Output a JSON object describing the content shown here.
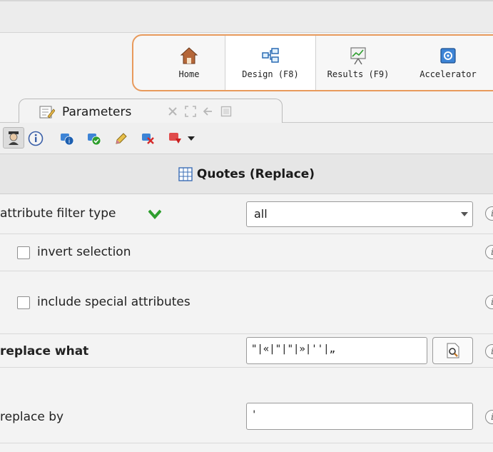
{
  "perspectives": {
    "home": {
      "label": "Home",
      "icon": "home-icon"
    },
    "design": {
      "label": "Design (F8)",
      "icon": "design-icon"
    },
    "results": {
      "label": "Results (F9)",
      "icon": "results-icon"
    },
    "accelerator": {
      "label": "Accelerator",
      "icon": "accelerator-icon"
    }
  },
  "panel_tab": {
    "label": "Parameters"
  },
  "operator": {
    "title": "Quotes (Replace)"
  },
  "params": {
    "attribute_filter_type": {
      "label": "attribute filter type",
      "value": "all"
    },
    "invert_selection": {
      "label": "invert selection",
      "checked": false
    },
    "include_special_attributes": {
      "label": "include special attributes",
      "checked": false
    },
    "replace_what": {
      "label": "replace what",
      "value": "\"|«|\"|\"|»|''|„"
    },
    "replace_by": {
      "label": "replace by",
      "value": "'"
    }
  },
  "colors": {
    "accent_orange": "#e89a5c",
    "check_green": "#2e9e2e"
  }
}
